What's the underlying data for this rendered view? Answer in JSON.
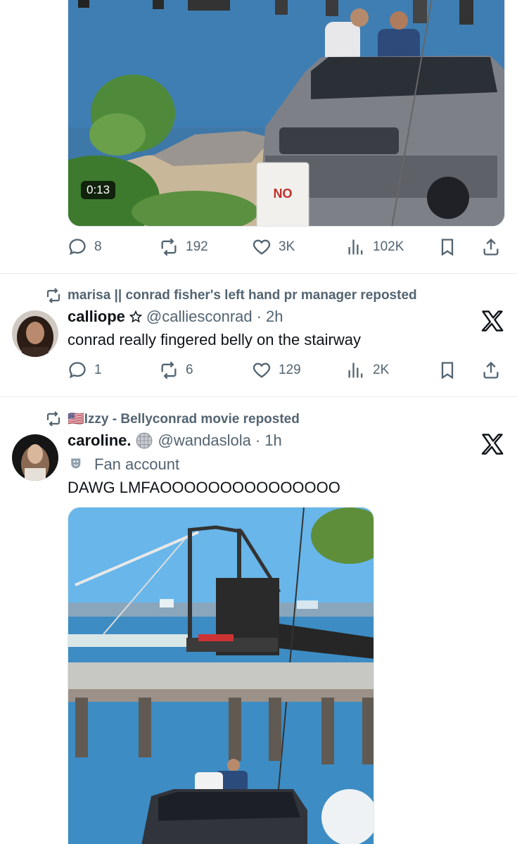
{
  "tweet1": {
    "video_duration": "0:13",
    "stats": {
      "replies": "8",
      "reposts": "192",
      "likes": "3K",
      "views": "102K"
    }
  },
  "tweet2": {
    "reposted_by": "marisa || conrad fisher's left hand pr manager reposted",
    "display_name": "calliope",
    "badge_icon": "star-badge-icon",
    "handle": "@calliesconrad",
    "time": "2h",
    "text": "conrad really fingered belly on the stairway",
    "stats": {
      "replies": "1",
      "reposts": "6",
      "likes": "129",
      "views": "2K"
    }
  },
  "tweet3": {
    "reposted_by": "🇺🇸Izzy - Bellyconrad movie reposted",
    "display_name": "caroline.",
    "badge_icon": "disco-ball-icon",
    "handle": "@wandaslola",
    "time": "1h",
    "account_label": "Fan account",
    "text": "DAWG LMFAOOOOOOOOOOOOOOO"
  },
  "separator": "·",
  "colors": {
    "text": "#0f1419",
    "muted": "#536471",
    "divider": "#e6ecf0"
  }
}
